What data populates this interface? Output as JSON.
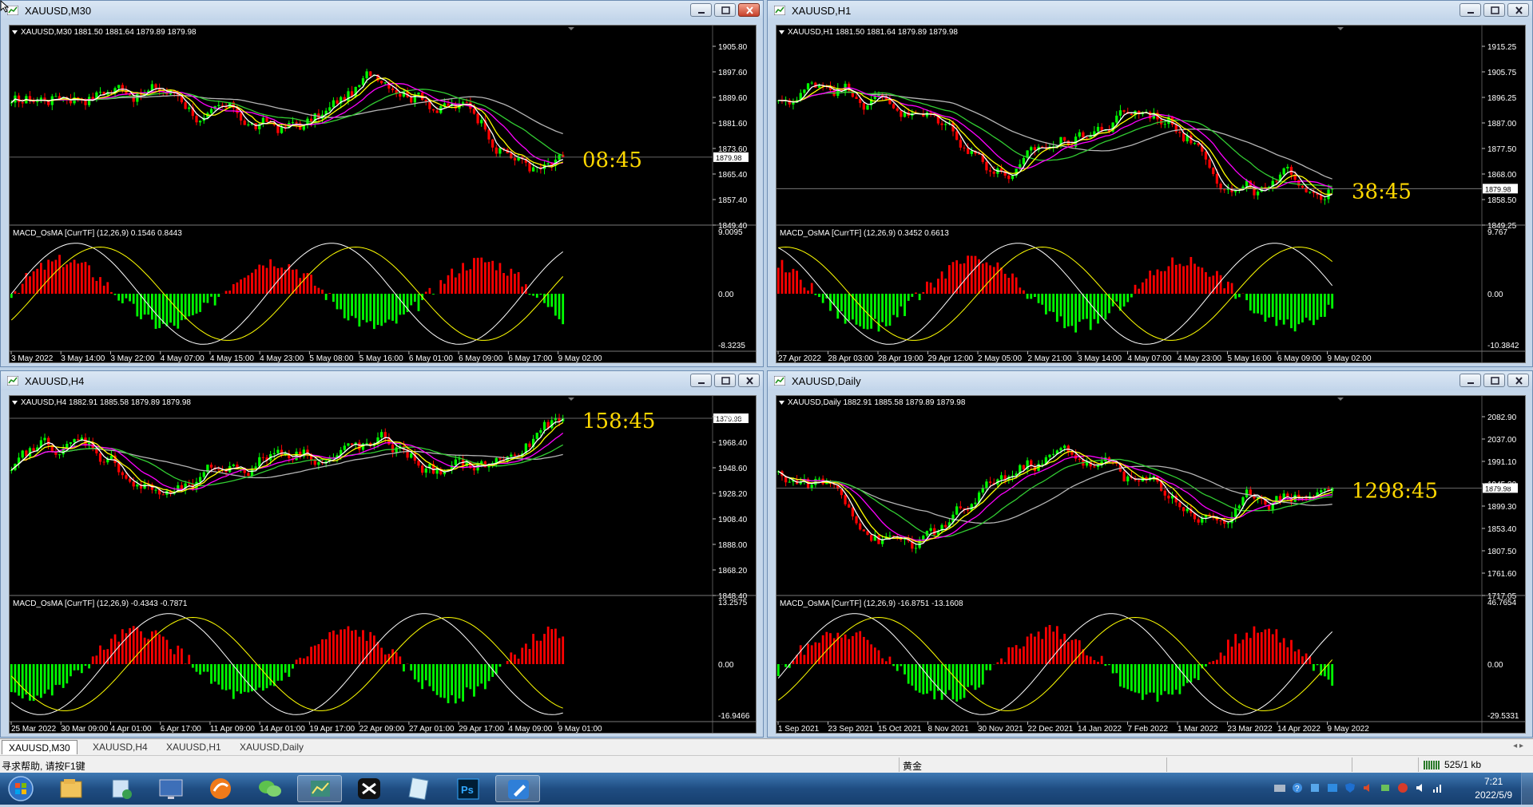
{
  "windows": [
    {
      "id": "m30",
      "title": "XAUUSD,M30",
      "header": "XAUUSD,M30  1881.50 1881.64 1879.89 1879.98",
      "price_ticks": [
        "1905.80",
        "1897.60",
        "1889.60",
        "1881.60",
        "1873.60",
        "1865.40",
        "1857.40",
        "1849.40"
      ],
      "current_price": "1879.98",
      "osc_label": "MACD_OsMA [CurrTF] (12,26,9) 0.1546 0.8443",
      "osc_ticks": [
        "9.0095",
        "0.00",
        "-8.3235"
      ],
      "time_labels": [
        "3 May 2022",
        "3 May 14:00",
        "3 May 22:00",
        "4 May 07:00",
        "4 May 15:00",
        "4 May 23:00",
        "5 May 08:00",
        "5 May 16:00",
        "6 May 01:00",
        "6 May 09:00",
        "6 May 17:00",
        "9 May 02:00"
      ],
      "timer": "08:45",
      "close_red": true
    },
    {
      "id": "h1",
      "title": "XAUUSD,H1",
      "header": "XAUUSD,H1  1881.50 1881.64 1879.89 1879.98",
      "price_ticks": [
        "1915.25",
        "1905.75",
        "1896.25",
        "1887.00",
        "1877.50",
        "1868.00",
        "1858.50",
        "1849.25"
      ],
      "current_price": "1879.98",
      "osc_label": "MACD_OsMA [CurrTF] (12,26,9) 0.3452 0.6613",
      "osc_ticks": [
        "9.767",
        "0.00",
        "-10.3842"
      ],
      "time_labels": [
        "27 Apr 2022",
        "28 Apr 03:00",
        "28 Apr 19:00",
        "29 Apr 12:00",
        "2 May 05:00",
        "2 May 21:00",
        "3 May 14:00",
        "4 May 07:00",
        "4 May 23:00",
        "5 May 16:00",
        "6 May 09:00",
        "9 May 02:00"
      ],
      "timer": "38:45",
      "close_red": false
    },
    {
      "id": "h4",
      "title": "XAUUSD,H4",
      "header": "XAUUSD,H4  1882.91 1885.58 1879.89 1879.98",
      "price_ticks": [
        "1988.20",
        "1968.40",
        "1948.60",
        "1928.20",
        "1908.40",
        "1888.00",
        "1868.20",
        "1848.40"
      ],
      "current_price": "1879.98",
      "osc_label": "MACD_OsMA [CurrTF] (12,26,9) -0.4343 -0.7871",
      "osc_ticks": [
        "13.2575",
        "0.00",
        "-16.9466"
      ],
      "time_labels": [
        "25 Mar 2022",
        "30 Mar 09:00",
        "4 Apr 01:00",
        "6 Apr 17:00",
        "11 Apr 09:00",
        "14 Apr 01:00",
        "19 Apr 17:00",
        "22 Apr 09:00",
        "27 Apr 01:00",
        "29 Apr 17:00",
        "4 May 09:00",
        "9 May 01:00"
      ],
      "timer": "158:45",
      "close_red": false
    },
    {
      "id": "d1",
      "title": "XAUUSD,Daily",
      "header": "XAUUSD,Daily  1882.91 1885.58 1879.89 1879.98",
      "price_ticks": [
        "2082.90",
        "2037.00",
        "1991.10",
        "1945.20",
        "1899.30",
        "1853.40",
        "1807.50",
        "1761.60",
        "1717.05"
      ],
      "current_price": "1879.98",
      "osc_label": "MACD_OsMA [CurrTF] (12,26,9) -16.8751 -13.1608",
      "osc_ticks": [
        "46.7654",
        "0.00",
        "-29.5331"
      ],
      "time_labels": [
        "1 Sep 2021",
        "23 Sep 2021",
        "15 Oct 2021",
        "8 Nov 2021",
        "30 Nov 2021",
        "22 Dec 2021",
        "14 Jan 2022",
        "7 Feb 2022",
        "1 Mar 2022",
        "23 Mar 2022",
        "14 Apr 2022",
        "9 May 2022"
      ],
      "timer": "1298:45",
      "close_red": false
    }
  ],
  "tabs": [
    "XAUUSD,M30",
    "XAUUSD,H4",
    "XAUUSD,H1",
    "XAUUSD,Daily"
  ],
  "status": {
    "help": "寻求帮助, 请按F1键",
    "symbol": "黄金",
    "traffic": "525/1 kb"
  },
  "clock": {
    "time": "7:21",
    "date": "2022/5/9"
  },
  "colors": {
    "up": "#00ff00",
    "down": "#ff0000",
    "ma_white": "#ffffff",
    "ma_yellow": "#ffff00",
    "ma_magenta": "#ff00ff",
    "ma_green": "#32cd32",
    "ma_gray": "#b4b4b4",
    "timer": "#ffd800"
  }
}
